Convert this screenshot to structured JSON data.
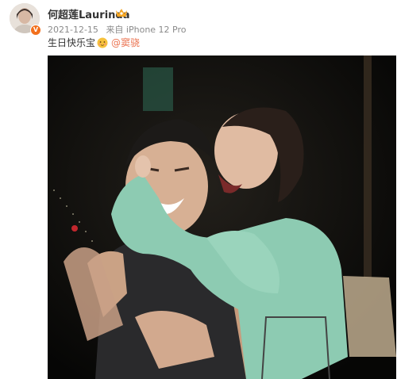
{
  "post": {
    "username": "何超莲Laurinda",
    "timestamp": "2021-12-15",
    "source": "来自 iPhone 12 Pro",
    "text_before": "生日快乐宝",
    "mention": "@窦骁"
  },
  "colors": {
    "verified_badge": "#f2701d",
    "mention": "#eb7350",
    "crown": "#f5a623"
  },
  "icons": {
    "verified": "verified-badge-icon",
    "vip": "crown-icon",
    "emoji": "blush-face-emoji-icon"
  }
}
